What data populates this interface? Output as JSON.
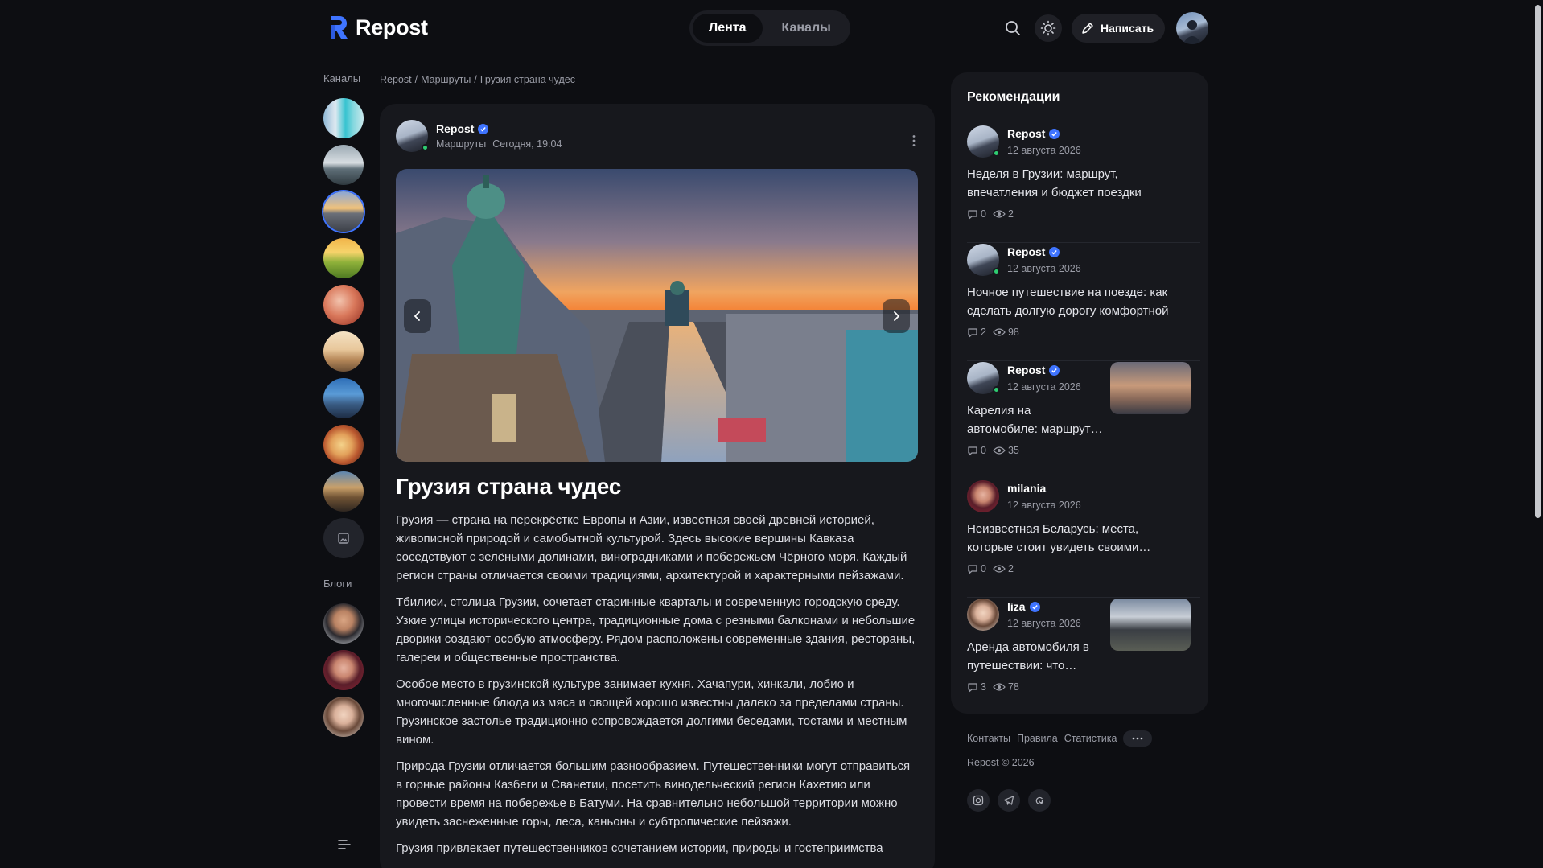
{
  "header": {
    "logo_text": "Repost",
    "tabs": [
      {
        "label": "Лента",
        "active": true
      },
      {
        "label": "Каналы",
        "active": false
      }
    ],
    "write_label": "Написать"
  },
  "sidebar": {
    "channels_label": "Каналы",
    "blogs_label": "Блоги",
    "channels": [
      "teal",
      "grey",
      "blue",
      "green",
      "red",
      "sand",
      "city",
      "food",
      "street"
    ],
    "blogs": [
      "man",
      "woman-1",
      "woman-2"
    ]
  },
  "breadcrumb": {
    "items": [
      "Repost",
      "Маршруты",
      "Грузия страна чудес"
    ],
    "separator": "/"
  },
  "post": {
    "author": "Repost",
    "category": "Маршруты",
    "time": "Сегодня, 19:04",
    "title": "Грузия страна чудес",
    "paragraphs": [
      "Грузия — страна на перекрёстке Европы и Азии, известная своей древней историей, живописной природой и самобытной культурой. Здесь высокие вершины Кавказа соседствуют с зелёными долинами, виноградниками и побережьем Чёрного моря. Каждый регион страны отличается своими традициями, архитектурой и характерными пейзажами.",
      "Тбилиси, столица Грузии, сочетает старинные кварталы и современную городскую среду. Узкие улицы исторического центра, традиционные дома с резными балконами и небольшие дворики создают особую атмосферу. Рядом расположены современные здания, рестораны, галереи и общественные пространства.",
      "Особое место в грузинской культуре занимает кухня. Хачапури, хинкали, лобио и многочисленные блюда из мяса и овощей хорошо известны далеко за пределами страны. Грузинское застолье традиционно сопровождается долгими беседами, тостами и местным вином.",
      "Природа Грузии отличается большим разнообразием. Путешественники могут отправиться в горные районы Казбеги и Сванетии, посетить винодельческий регион Кахетию или провести время на побережье в Батуми. На сравнительно небольшой территории можно увидеть заснеженные горы, леса, каньоны и субтропические пейзажи.",
      "Грузия привлекает путешественников сочетанием истории, природы и гостеприимства"
    ]
  },
  "recommendations": {
    "title": "Рекомендации",
    "items": [
      {
        "author": "Repost",
        "verified": true,
        "online": true,
        "date": "12 августа 2026",
        "text": "Неделя в Грузии: маршрут, впечатления и бюджет поездки",
        "comments": "0",
        "views": "2",
        "thumb": false
      },
      {
        "author": "Repost",
        "verified": true,
        "online": true,
        "date": "12 августа 2026",
        "text": "Ночное путешествие на поезде: как сделать долгую дорогу комфортной",
        "comments": "2",
        "views": "98",
        "thumb": false
      },
      {
        "author": "Repost",
        "verified": true,
        "online": true,
        "date": "12 августа 2026",
        "text": "Карелия на автомобиле: маршрут…",
        "text_line1": "Карелия на",
        "text_line2": "автомобиле: маршрут…",
        "comments": "0",
        "views": "35",
        "thumb": true
      },
      {
        "author": "milania",
        "verified": false,
        "online": false,
        "date": "12 августа 2026",
        "text": "Неизвестная Беларусь: места, которые стоит увидеть своими…",
        "comments": "0",
        "views": "2",
        "thumb": false
      },
      {
        "author": "liza",
        "verified": true,
        "online": false,
        "date": "12 августа 2026",
        "text": "Аренда автомобиля в путешествии: что…",
        "text_line1": "Аренда автомобиля в",
        "text_line2": "путешествии: что…",
        "comments": "3",
        "views": "78",
        "thumb": true
      }
    ]
  },
  "footer": {
    "links": [
      "Контакты",
      "Правила",
      "Статистика"
    ],
    "copyright": "Repost © 2026",
    "social": [
      "instagram-icon",
      "telegram-icon",
      "threads-icon"
    ]
  },
  "colors": {
    "background": "#0d0e12",
    "card": "#17181d",
    "accent": "#3f74ff",
    "online": "#2ecc71"
  }
}
